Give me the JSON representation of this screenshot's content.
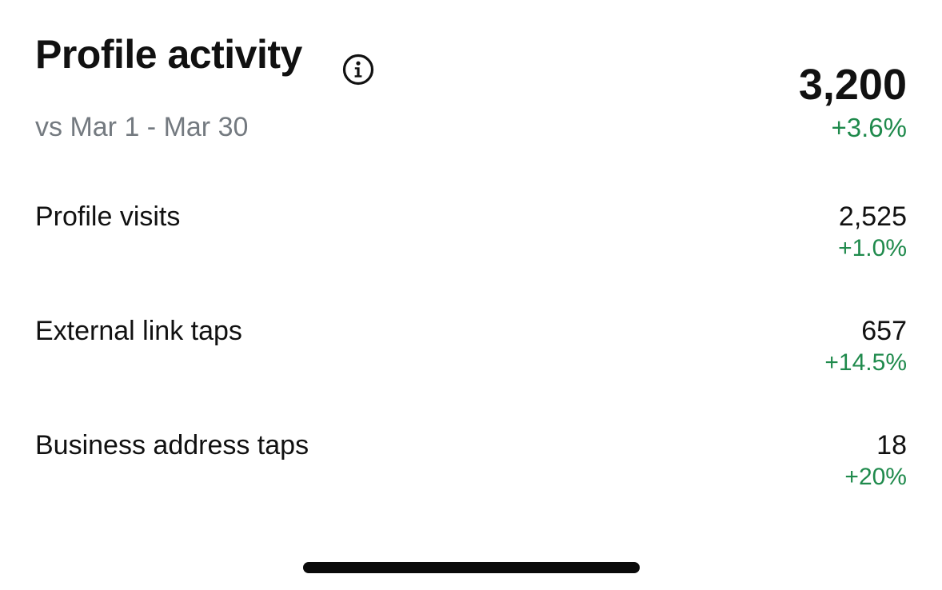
{
  "header": {
    "title": "Profile activity",
    "info_icon": "info-circle-icon",
    "comparison": "vs Mar 1 - Mar 30"
  },
  "summary": {
    "total": "3,200",
    "change": "+3.6%"
  },
  "metrics": [
    {
      "label": "Profile visits",
      "value": "2,525",
      "change": "+1.0%"
    },
    {
      "label": "External link taps",
      "value": "657",
      "change": "+14.5%"
    },
    {
      "label": "Business address taps",
      "value": "18",
      "change": "+20%"
    }
  ],
  "colors": {
    "positive": "#1f8a4c",
    "muted": "#747a80",
    "text": "#111111"
  }
}
